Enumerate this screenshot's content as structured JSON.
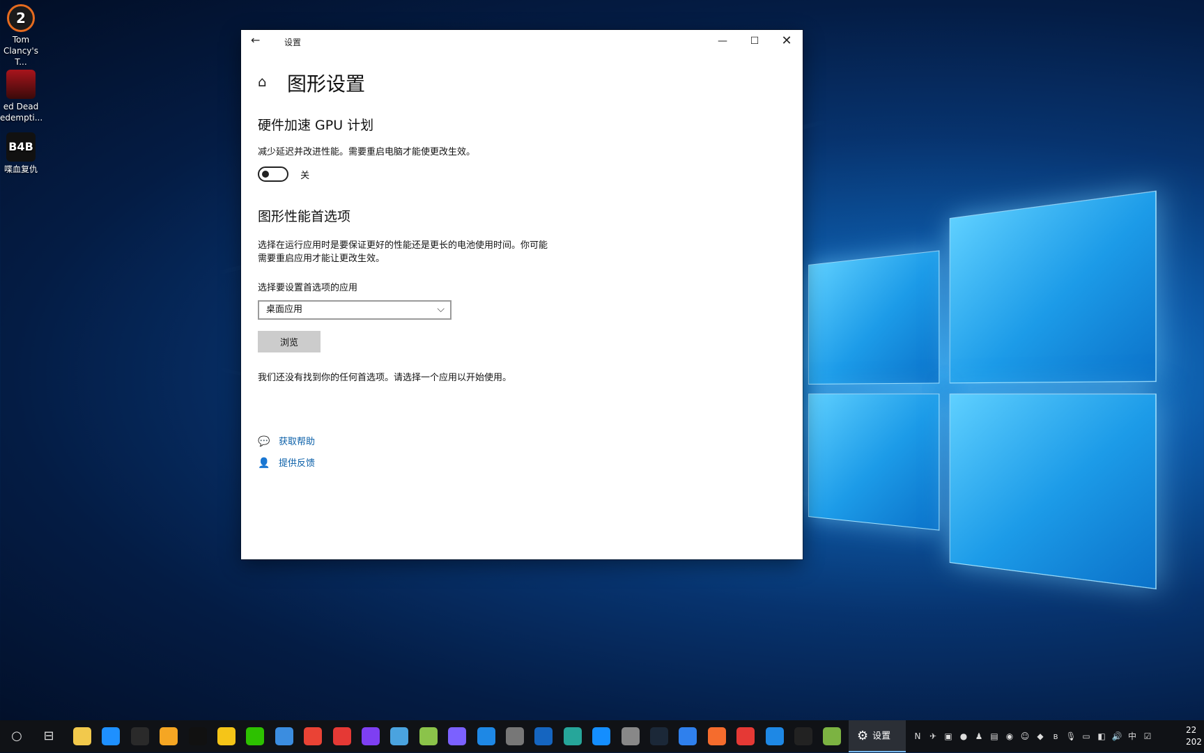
{
  "desktop": {
    "icons": [
      {
        "glyph": "2",
        "label": "Tom Clancy's T..."
      },
      {
        "glyph": "",
        "label": "ed Dead edempti..."
      },
      {
        "glyph": "B4B",
        "label": "喋血复仇"
      }
    ]
  },
  "window": {
    "title": "设置",
    "back_icon": "←",
    "min_icon": "—",
    "max_icon": "☐",
    "close_icon": "✕"
  },
  "page": {
    "home_icon": "⌂",
    "title": "图形设置",
    "gpu_section": {
      "heading": "硬件加速 GPU 计划",
      "description": "减少延迟并改进性能。需要重启电脑才能使更改生效。",
      "toggle_state": "关"
    },
    "perf_section": {
      "heading": "图形性能首选项",
      "description_line1": "选择在运行应用时是要保证更好的性能还是更长的电池使用时间。你可能",
      "description_line2": "需要重启应用才能让更改生效。",
      "select_label": "选择要设置首选项的应用",
      "select_value": "桌面应用",
      "browse_label": "浏览",
      "empty_message": "我们还没有找到你的任何首选项。请选择一个应用以开始使用。"
    },
    "links": {
      "help": "获取帮助",
      "feedback": "提供反馈"
    }
  },
  "taskbar": {
    "search_icon": "○",
    "taskview_icon": "⊟",
    "active_task_label": "设置",
    "apps": [
      {
        "name": "file-explorer",
        "color": "#f2c94c"
      },
      {
        "name": "edge-legacy",
        "color": "#1e90ff"
      },
      {
        "name": "epic-games",
        "color": "#2a2a2a"
      },
      {
        "name": "shield",
        "color": "#f5a623"
      },
      {
        "name": "qq",
        "color": "#111111"
      },
      {
        "name": "game-app",
        "color": "#f5c518"
      },
      {
        "name": "wechat",
        "color": "#2dc100"
      },
      {
        "name": "chat-app",
        "color": "#3b8de0"
      },
      {
        "name": "chrome",
        "color": "#ea4335"
      },
      {
        "name": "red-app",
        "color": "#e53935"
      },
      {
        "name": "purple-ring",
        "color": "#7e3ff2"
      },
      {
        "name": "blue-bird",
        "color": "#4aa3df"
      },
      {
        "name": "green-app",
        "color": "#8bc34a"
      },
      {
        "name": "w-app",
        "color": "#7b61ff"
      },
      {
        "name": "bolt-app",
        "color": "#1e88e5"
      },
      {
        "name": "calculator",
        "color": "#777777"
      },
      {
        "name": "ring-app",
        "color": "#1565c0"
      },
      {
        "name": "ship-app",
        "color": "#26a69a"
      },
      {
        "name": "battlenet",
        "color": "#148eff"
      },
      {
        "name": "steelseries",
        "color": "#888888"
      },
      {
        "name": "steam",
        "color": "#1b2838"
      },
      {
        "name": "uplay",
        "color": "#2f80ed"
      },
      {
        "name": "origin",
        "color": "#f56c2d"
      },
      {
        "name": "record",
        "color": "#e53935"
      },
      {
        "name": "kugou",
        "color": "#1e88e5"
      },
      {
        "name": "rockstar",
        "color": "#222222"
      },
      {
        "name": "xbox-app",
        "color": "#7cb342"
      }
    ],
    "tray_icons": [
      "N",
      "✈",
      "▣",
      "●",
      "♟",
      "▤",
      "◉",
      "☺",
      "◆",
      "ʙ",
      "🎙",
      "▭",
      "◧",
      "🔊",
      "中",
      "☑"
    ],
    "clock_line1": "22",
    "clock_line2": "202"
  },
  "colors": {
    "accent_link": "#0a5fa8",
    "taskbar_bg": "#101216",
    "active_underline": "#76b9ed"
  }
}
